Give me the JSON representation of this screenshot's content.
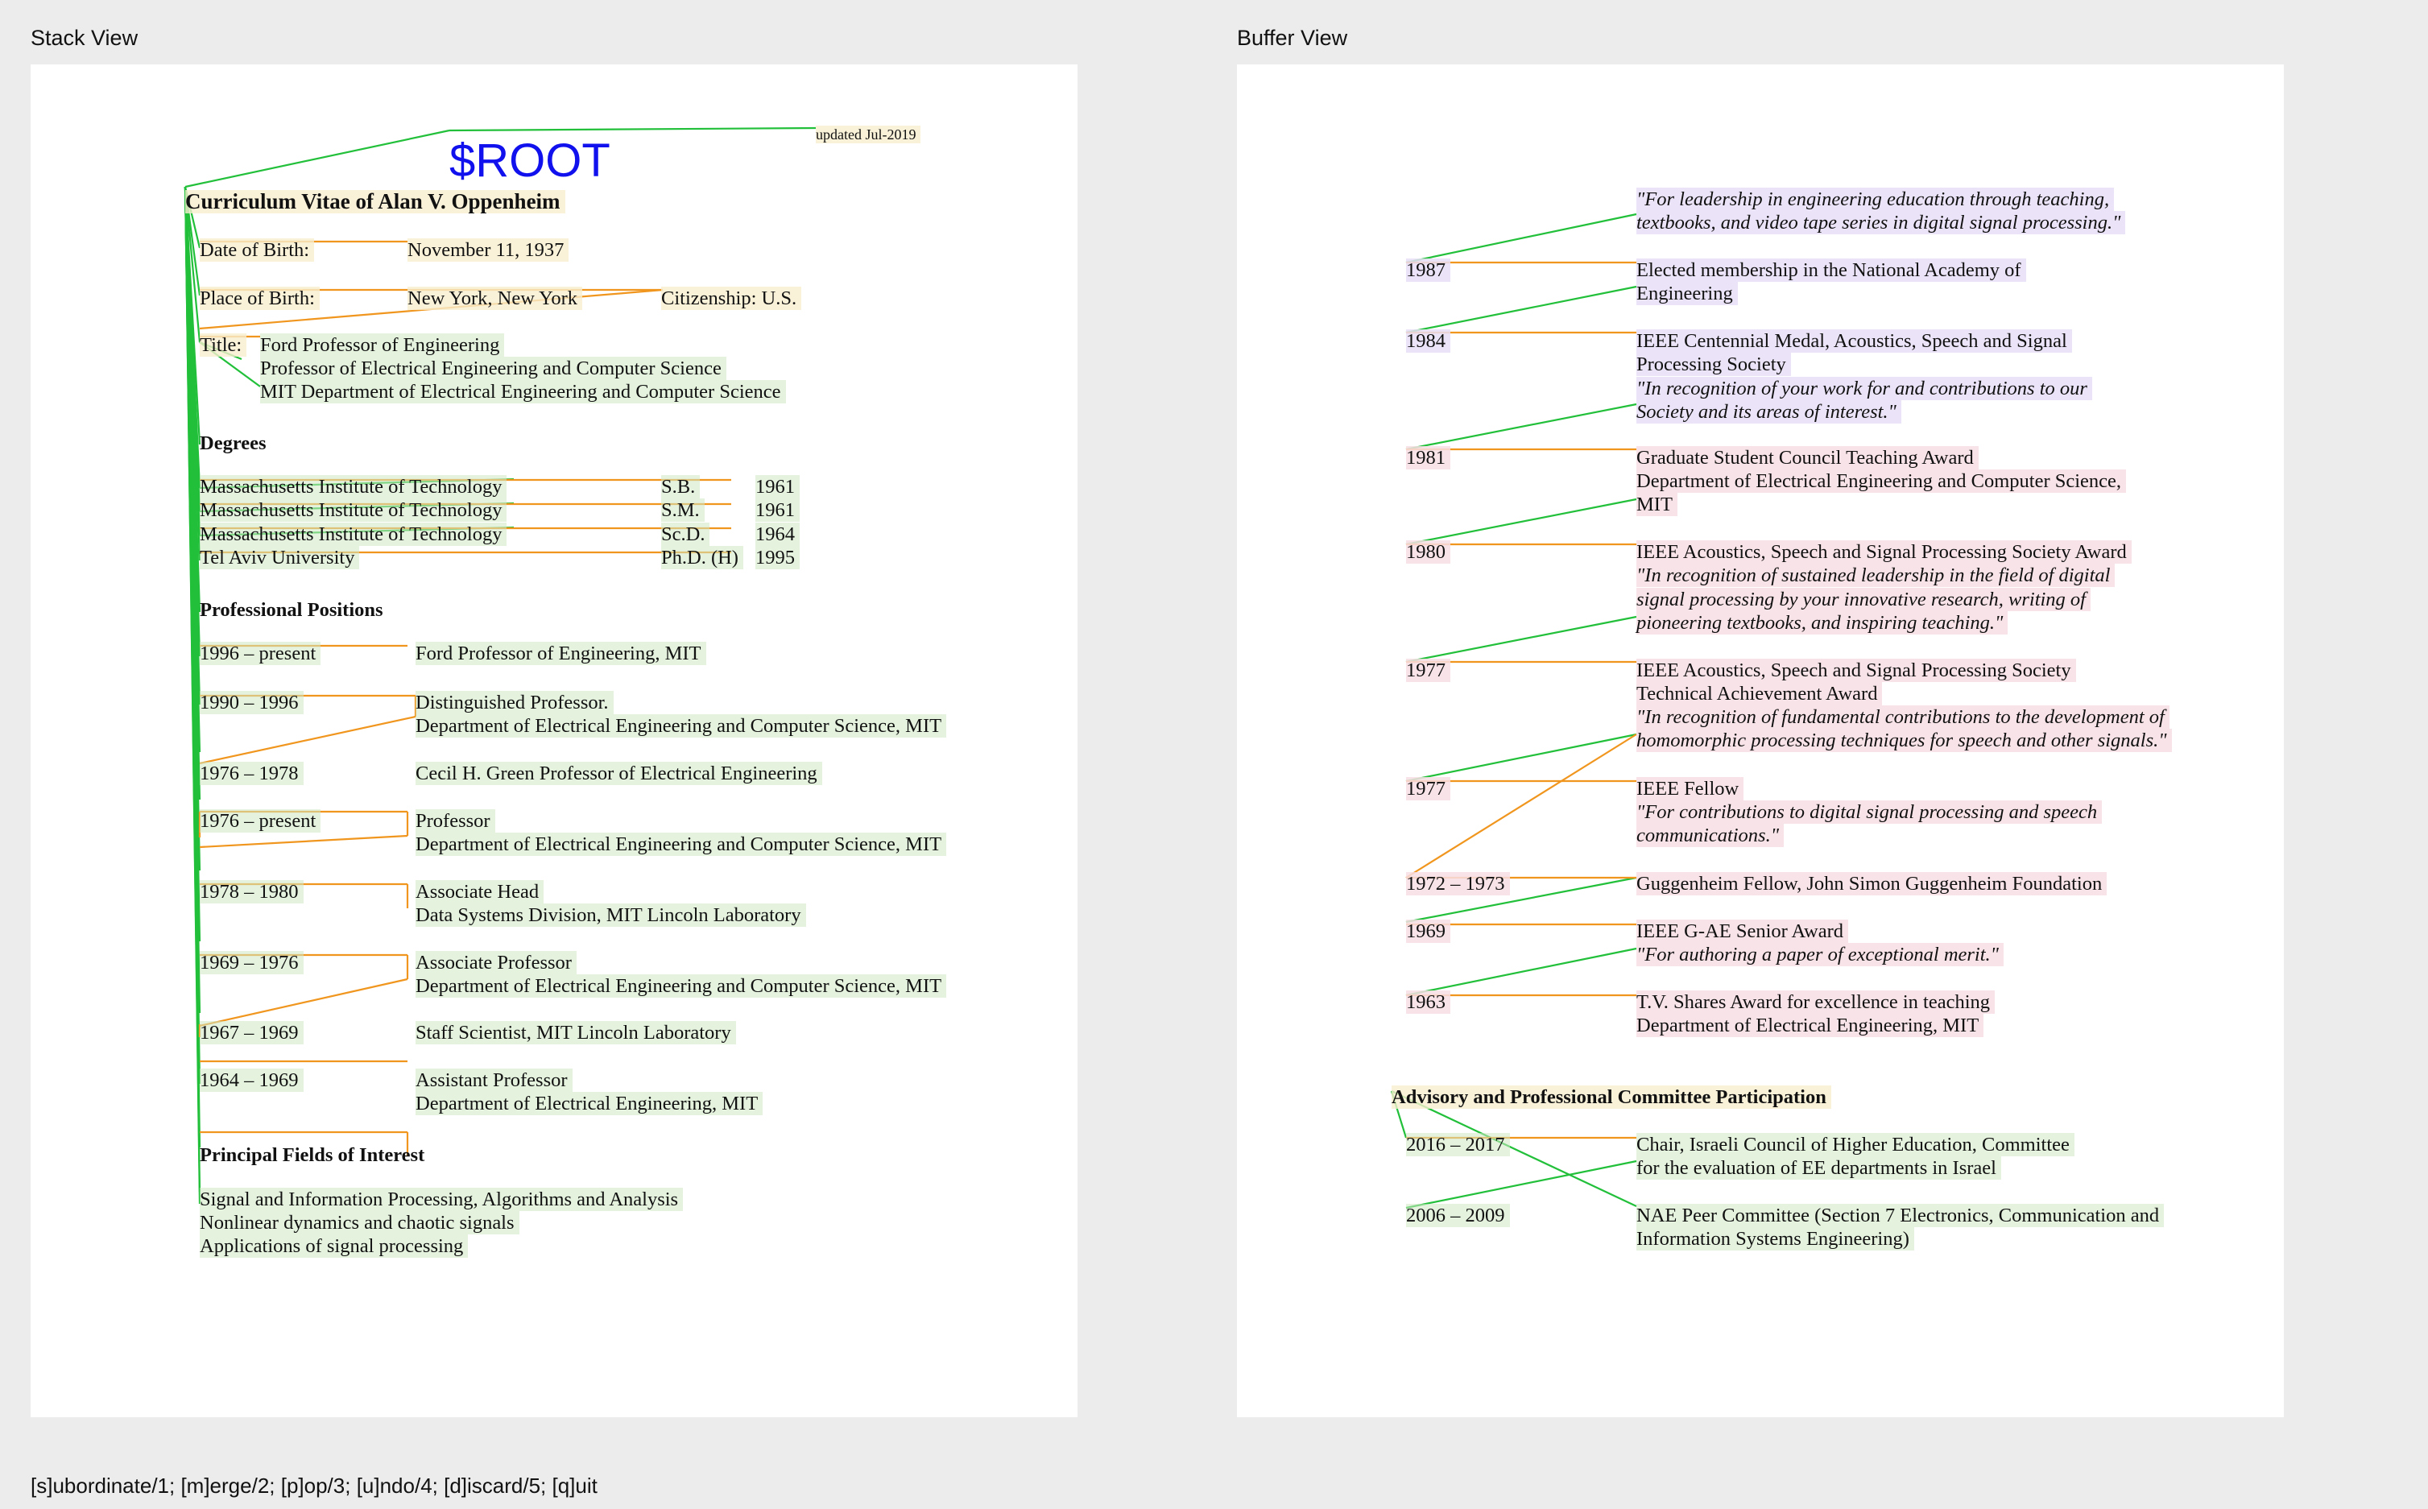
{
  "stack_view": {
    "title": "Stack View",
    "root_label": "$ROOT",
    "updated": "updated Jul-2019",
    "cv_title": "Curriculum Vitae of Alan V. Oppenheim",
    "dob_label": "Date of Birth:",
    "dob_value": "November 11, 1937",
    "pob_label": "Place of Birth:",
    "pob_value": "New York, New York",
    "citizenship": "Citizenship:  U.S.",
    "title_label": "Title:",
    "title_lines": [
      "Ford Professor of Engineering",
      "Professor of Electrical Engineering and Computer Science",
      "MIT Department of Electrical Engineering and Computer Science"
    ],
    "degrees_heading": "Degrees",
    "degrees": [
      {
        "school": "Massachusetts Institute of Technology",
        "degree": "S.B.",
        "year": "1961"
      },
      {
        "school": "Massachusetts Institute of Technology",
        "degree": "S.M.",
        "year": "1961"
      },
      {
        "school": "Massachusetts Institute of Technology",
        "degree": "Sc.D.",
        "year": "1964"
      },
      {
        "school": "Tel Aviv University",
        "degree": "Ph.D. (H)",
        "year": "1995"
      }
    ],
    "positions_heading": "Professional Positions",
    "positions": [
      {
        "dates": "1996 – present",
        "line1": "Ford Professor of Engineering, MIT",
        "line2": ""
      },
      {
        "dates": "1990 – 1996",
        "line1": "Distinguished Professor.",
        "line2": "Department of Electrical Engineering and Computer Science, MIT"
      },
      {
        "dates": "1976 – 1978",
        "line1": "Cecil H. Green Professor of Electrical Engineering",
        "line2": ""
      },
      {
        "dates": "1976 – present",
        "line1": "Professor",
        "line2": "Department of Electrical Engineering and Computer Science, MIT"
      },
      {
        "dates": "1978 – 1980",
        "line1": "Associate Head",
        "line2": "Data Systems Division, MIT Lincoln Laboratory"
      },
      {
        "dates": "1969 – 1976",
        "line1": "Associate Professor",
        "line2": "Department of Electrical Engineering and Computer Science, MIT"
      },
      {
        "dates": "1967 – 1969",
        "line1": "Staff Scientist, MIT Lincoln Laboratory",
        "line2": ""
      },
      {
        "dates": "1964 – 1969",
        "line1": "Assistant Professor",
        "line2": "Department of Electrical Engineering, MIT"
      }
    ],
    "fields_heading": "Principal Fields of Interest",
    "fields": [
      "Signal and Information Processing, Algorithms and Analysis",
      "Nonlinear dynamics and chaotic signals",
      "Applications of signal processing"
    ]
  },
  "buffer_view": {
    "title": "Buffer View",
    "quote_top": [
      "\"For leadership in engineering education through teaching,",
      "textbooks, and video tape series in digital signal processing.\""
    ],
    "awards": [
      {
        "year": "1987",
        "lines": [
          "Elected membership in the National Academy of",
          "Engineering"
        ],
        "italic": []
      },
      {
        "year": "1984",
        "lines": [
          "IEEE Centennial Medal, Acoustics, Speech and Signal",
          "Processing Society"
        ],
        "italic": [
          "\"In recognition of your work for and contributions to our",
          "Society and its areas of interest.\""
        ]
      },
      {
        "year": "1981",
        "lines": [
          "Graduate Student Council Teaching Award",
          "Department of Electrical Engineering and Computer Science,",
          "MIT"
        ],
        "italic": []
      },
      {
        "year": "1980",
        "lines": [
          "IEEE Acoustics, Speech and Signal Processing Society Award"
        ],
        "italic": [
          "\"In recognition of sustained leadership in the field of digital",
          "signal processing by your innovative research, writing of",
          "pioneering textbooks, and inspiring teaching.\""
        ]
      },
      {
        "year": "1977",
        "lines": [
          "IEEE Acoustics, Speech and Signal Processing Society",
          "Technical Achievement Award"
        ],
        "italic": [
          "\"In recognition of fundamental contributions to the development of",
          "homomorphic processing techniques for speech and other signals.\""
        ]
      },
      {
        "year": "1977",
        "lines": [
          "IEEE Fellow"
        ],
        "italic": [
          "\"For contributions to digital signal processing and speech",
          "communications.\""
        ]
      },
      {
        "year": "1972 – 1973",
        "lines": [
          "Guggenheim Fellow, John Simon Guggenheim Foundation"
        ],
        "italic": []
      },
      {
        "year": "1969",
        "lines": [
          "IEEE G-AE Senior Award"
        ],
        "italic": [
          "\"For authoring a paper of exceptional merit.\""
        ]
      },
      {
        "year": "1963",
        "lines": [
          "T.V. Shares Award for excellence in teaching",
          "Department of Electrical Engineering, MIT"
        ],
        "italic": []
      }
    ],
    "advisory_heading": "Advisory and Professional Committee Participation",
    "committees": [
      {
        "dates": "2016 – 2017",
        "lines": [
          "Chair, Israeli Council of Higher Education, Committee",
          "for the evaluation of EE departments in Israel"
        ]
      },
      {
        "dates": "2006 – 2009",
        "lines": [
          "NAE Peer Committee (Section 7 Electronics, Communication and",
          "Information Systems Engineering)"
        ]
      }
    ]
  },
  "command_bar": "[s]ubordinate/1; [m]erge/2; [p]op/3; [u]ndo/4; [d]iscard/5; [q]uit"
}
